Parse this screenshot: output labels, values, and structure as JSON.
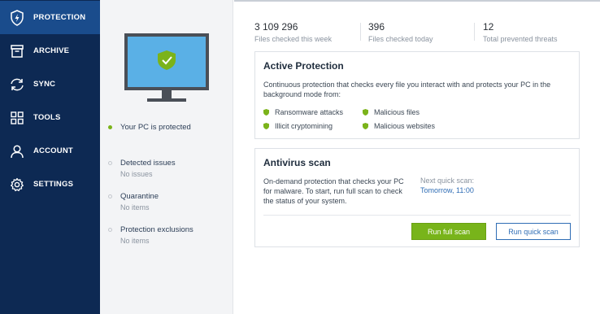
{
  "sidebar": {
    "items": [
      {
        "label": "PROTECTION",
        "icon": "shield-icon",
        "active": true
      },
      {
        "label": "ARCHIVE",
        "icon": "archive-icon",
        "active": false
      },
      {
        "label": "SYNC",
        "icon": "sync-icon",
        "active": false
      },
      {
        "label": "TOOLS",
        "icon": "tools-grid-icon",
        "active": false
      },
      {
        "label": "ACCOUNT",
        "icon": "account-icon",
        "active": false
      },
      {
        "label": "SETTINGS",
        "icon": "gear-icon",
        "active": false
      }
    ]
  },
  "status": {
    "protected": "Your PC is protected",
    "detected_title": "Detected issues",
    "detected_sub": "No issues",
    "quarantine_title": "Quarantine",
    "quarantine_sub": "No items",
    "exclusions_title": "Protection exclusions",
    "exclusions_sub": "No items"
  },
  "stats": [
    {
      "value": "3 109 296",
      "label": "Files checked this week"
    },
    {
      "value": "396",
      "label": "Files checked today"
    },
    {
      "value": "12",
      "label": "Total prevented threats"
    }
  ],
  "active_protection": {
    "title": "Active Protection",
    "description_line1": "Continuous protection that checks every file you interact with and protects your PC in the",
    "description_line2": "background mode from:",
    "features": [
      "Ransomware attacks",
      "Illicit cryptomining",
      "Malicious files",
      "Malicious websites"
    ]
  },
  "antivirus": {
    "title": "Antivirus scan",
    "description_line1": "On-demand protection that checks your PC",
    "description_line2": "for malware. To start, run full scan to check",
    "description_line3": "the status of your system.",
    "next_label": "Next quick scan:",
    "next_value": "Tomorrow, 11:00",
    "run_full_label": "Run full scan",
    "run_quick_label": "Run quick scan"
  },
  "colors": {
    "sidebar_bg": "#0d2953",
    "sidebar_active": "#1a4c8c",
    "accent_green": "#78b41a",
    "link_blue": "#2f6db5"
  }
}
